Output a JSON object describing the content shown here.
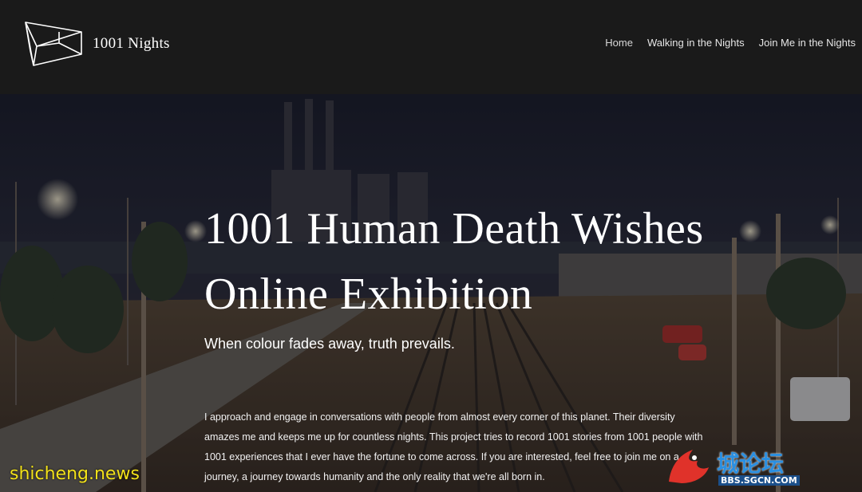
{
  "header": {
    "site_title": "1001 Nights",
    "logo_icon": "geometric-box-logo-icon",
    "nav": [
      {
        "label": "Home",
        "active": true
      },
      {
        "label": "Walking in the Nights",
        "active": false
      },
      {
        "label": "Join Me in the Nights",
        "active": false
      }
    ]
  },
  "hero": {
    "title_line1": "1001 Human Death Wishes",
    "title_line2": "Online Exhibition",
    "subtitle": "When colour fades away, truth prevails.",
    "body_line1": "I approach and engage in conversations with people from almost every corner of this planet. Their diversity",
    "body_line2": "amazes me and keeps me up for countless nights. This project tries to record 1001 stories from 1001 people with",
    "body_line3": "1001 experiences that I ever have the fortune to come across. If you are interested, feel free to join me on a",
    "body_line4": "journey, a journey towards humanity and the only reality that we're all born in."
  },
  "watermarks": {
    "left": "shicheng.news",
    "right_cn": "城论坛",
    "right_url": "BBS.SGCN.COM"
  },
  "colors": {
    "header_bg": "#1a1a1a",
    "text": "#ffffff",
    "watermark_yellow": "#f3e21a",
    "watermark_blue": "#2b8fe0"
  }
}
